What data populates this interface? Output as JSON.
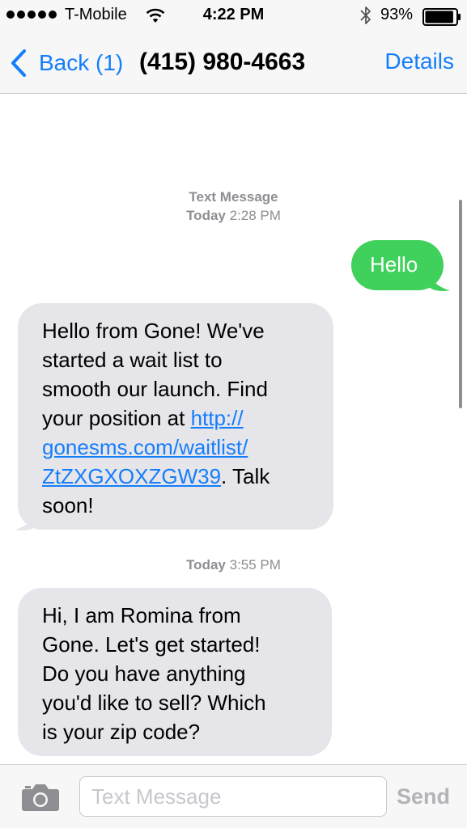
{
  "status_bar": {
    "carrier": "T-Mobile",
    "time": "4:22 PM",
    "battery": "93%",
    "battery_level": 0.93,
    "signal_bars": 5,
    "icons": [
      "signal-dots-icon",
      "wifi-icon",
      "bluetooth-icon",
      "battery-icon"
    ]
  },
  "nav": {
    "back_label": "Back (1)",
    "title": "(415) 980-4663",
    "details_label": "Details",
    "back_icon": "chevron-left-icon"
  },
  "conversation": {
    "type_label": "Text Message",
    "stamp1": {
      "day": "Today",
      "time": "2:28 PM"
    },
    "stamp2": {
      "day": "Today",
      "time": "3:55 PM"
    },
    "sent_message": "Hello",
    "message1": {
      "line1": "Hello from Gone! We've",
      "line2": "started a wait list to",
      "line3": "smooth our launch. Find",
      "line4_text": "your position at ",
      "link_part1": "http://",
      "link_part2": "gonesms.com/waitlist/",
      "link_part3": "ZtZXGXOXZGW39",
      "after_link": ". Talk",
      "line7": "soon!"
    },
    "message2": {
      "line1": "Hi, I am Romina from",
      "line2": "Gone. Let's get started!",
      "line3": "Do you have anything",
      "line4": "you'd like to sell? Which",
      "line5": "is your zip code?"
    }
  },
  "input_bar": {
    "placeholder": "Text Message",
    "value": "",
    "send_label": "Send",
    "camera_icon": "camera-icon"
  },
  "colors": {
    "accent": "#147efb",
    "sent_bubble": "#3fd15b",
    "received_bubble": "#e6e5ea"
  }
}
